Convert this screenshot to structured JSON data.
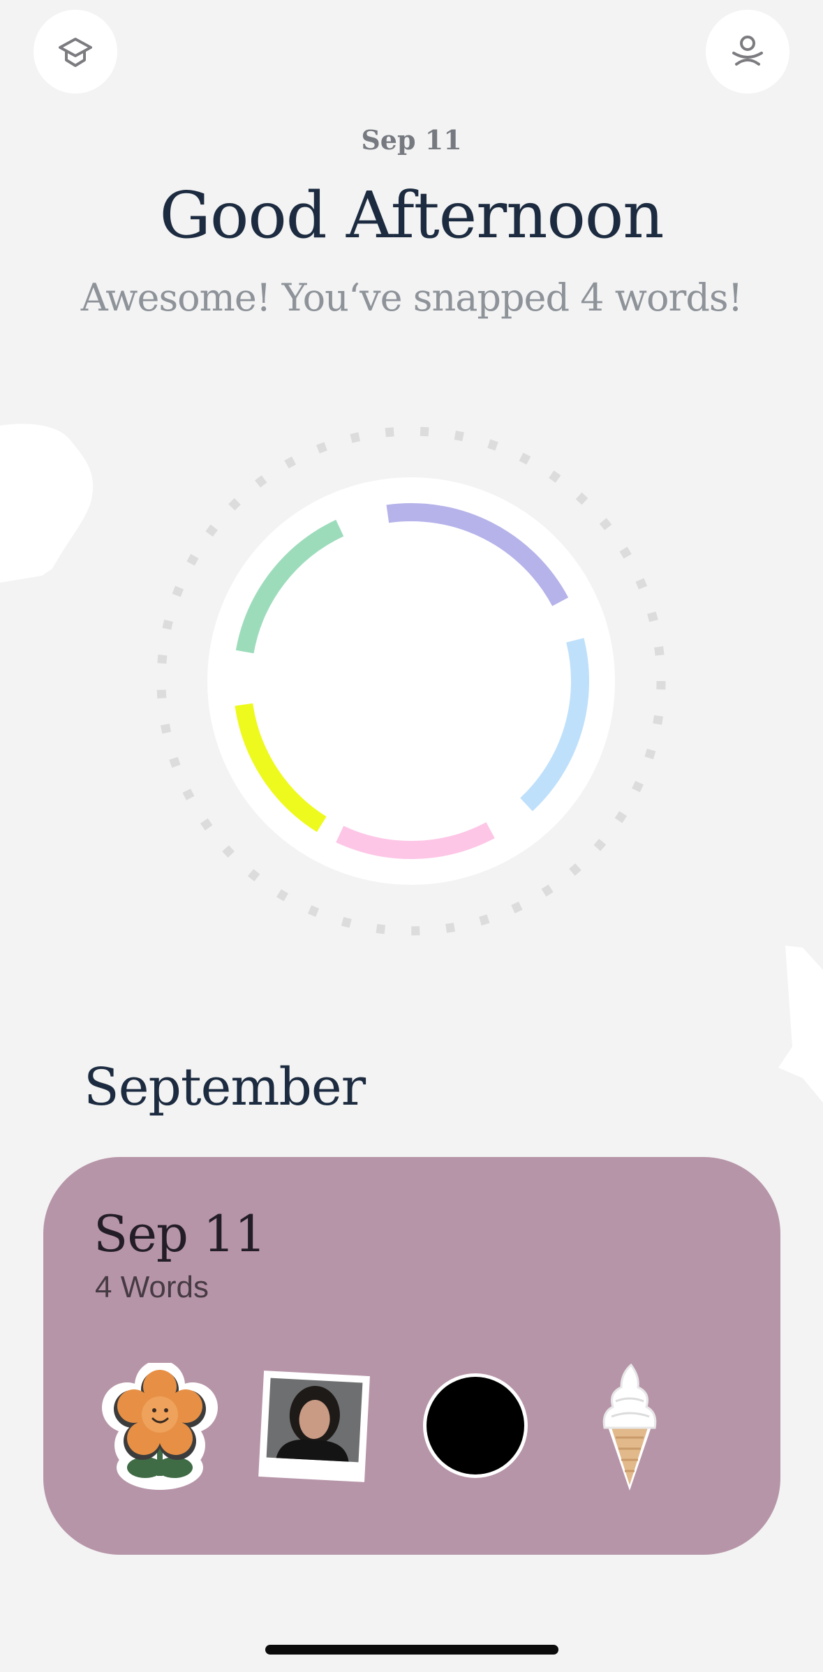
{
  "header": {
    "left_icon": "graduation-cap-icon",
    "right_icon": "profile-icon",
    "date": "Sep 11",
    "greeting": "Good Afternoon",
    "subtitle": "Awesome! You‘ve snapped 4 words!"
  },
  "ring": {
    "segments": [
      {
        "name": "green",
        "color": "#9cdcbb"
      },
      {
        "name": "purple",
        "color": "#b6b3ea"
      },
      {
        "name": "blue",
        "color": "#bfe0fb"
      },
      {
        "name": "pink",
        "color": "#fdc6e6"
      },
      {
        "name": "yellow",
        "color": "#eefa1e"
      }
    ]
  },
  "month_section": {
    "title": "September",
    "card": {
      "date": "Sep 11",
      "count": "4 Words",
      "background": "#b795a8",
      "stickers": [
        "flower-sticker",
        "photo-sticker",
        "black-circle-sticker",
        "ice-cream-sticker"
      ]
    }
  }
}
